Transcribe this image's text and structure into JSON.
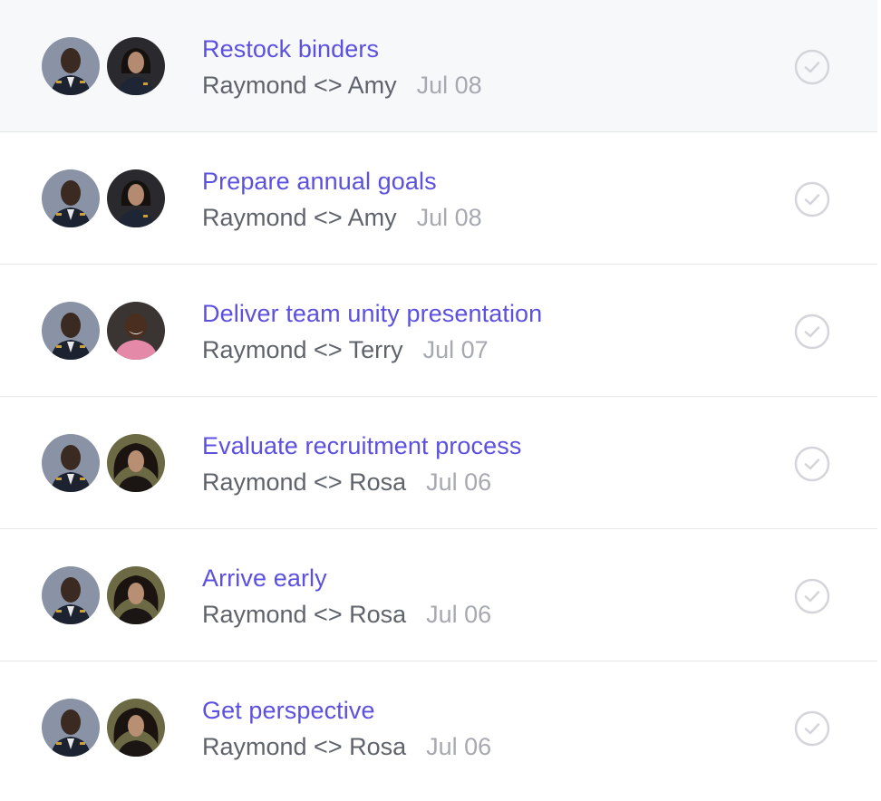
{
  "colors": {
    "title": "#5b50e0",
    "meta": "#5f636b",
    "date": "#a6a9b0",
    "check": "#d4d5da",
    "row_active_bg": "#f7f8fa"
  },
  "tasks": [
    {
      "title": "Restock binders",
      "people": "Raymond <> Amy",
      "date": "Jul 08",
      "avatar_left": "raymond",
      "avatar_right": "amy",
      "active": true
    },
    {
      "title": "Prepare annual goals",
      "people": "Raymond <> Amy",
      "date": "Jul 08",
      "avatar_left": "raymond",
      "avatar_right": "amy",
      "active": false
    },
    {
      "title": "Deliver team unity presentation",
      "people": "Raymond <> Terry",
      "date": "Jul 07",
      "avatar_left": "raymond",
      "avatar_right": "terry",
      "active": false
    },
    {
      "title": "Evaluate recruitment process",
      "people": "Raymond <> Rosa",
      "date": "Jul 06",
      "avatar_left": "raymond",
      "avatar_right": "rosa",
      "active": false
    },
    {
      "title": "Arrive early",
      "people": "Raymond <> Rosa",
      "date": "Jul 06",
      "avatar_left": "raymond",
      "avatar_right": "rosa",
      "active": false
    },
    {
      "title": "Get perspective",
      "people": "Raymond <> Rosa",
      "date": "Jul 06",
      "avatar_left": "raymond",
      "avatar_right": "rosa",
      "active": false
    }
  ],
  "icons": {
    "complete": "check-circle-icon"
  }
}
